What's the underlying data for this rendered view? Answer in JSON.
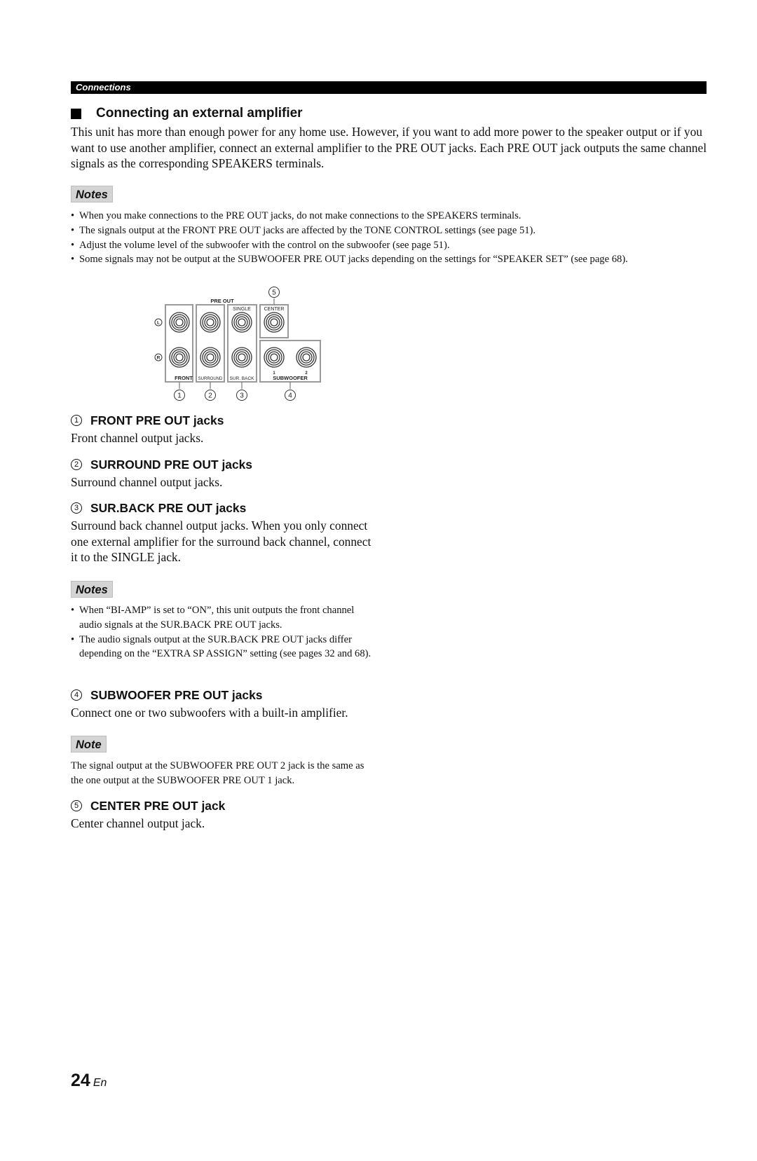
{
  "header": {
    "section": "Connections"
  },
  "section": {
    "title": "Connecting an external amplifier",
    "intro": "This unit has more than enough power for any home use. However, if you want to add more power to the speaker output or if you want to use another amplifier, connect an external amplifier to the PRE OUT jacks. Each PRE OUT jack outputs the same channel signals as the corresponding SPEAKERS terminals."
  },
  "notes_top": {
    "label": "Notes",
    "items": [
      "When you make connections to the PRE OUT jacks, do not make connections to the SPEAKERS terminals.",
      "The signals output at the FRONT PRE OUT jacks are affected by the TONE CONTROL settings (see page 51).",
      "Adjust the volume level of the subwoofer with the control on the subwoofer (see page 51).",
      "Some signals may not be output at the SUBWOOFER PRE OUT jacks depending on the settings for “SPEAKER SET” (see page 68)."
    ]
  },
  "diagram": {
    "title": "PRE OUT",
    "channel_left": "L",
    "channel_right": "R",
    "groups": {
      "front": "FRONT",
      "surround": "SURROUND",
      "sur_back": "SUR. BACK",
      "single": "SINGLE",
      "center": "CENTER",
      "subwoofer": "SUBWOOFER",
      "sub1": "1",
      "sub2": "2"
    },
    "callouts": [
      "1",
      "2",
      "3",
      "4",
      "5"
    ]
  },
  "items": [
    {
      "num": "1",
      "title": "FRONT PRE OUT jacks",
      "body": "Front channel output jacks."
    },
    {
      "num": "2",
      "title": "SURROUND PRE OUT jacks",
      "body": "Surround channel output jacks."
    },
    {
      "num": "3",
      "title": "SUR.BACK PRE OUT jacks",
      "body": "Surround back channel output jacks. When you only connect one external amplifier for the surround back channel, connect it to the SINGLE jack."
    },
    {
      "num": "4",
      "title": "SUBWOOFER PRE OUT jacks",
      "body": "Connect one or two subwoofers with a built-in amplifier."
    },
    {
      "num": "5",
      "title": "CENTER PRE OUT jack",
      "body": "Center channel output jack."
    }
  ],
  "notes_surback": {
    "label": "Notes",
    "items": [
      "When “BI-AMP” is set to “ON”, this unit outputs the front channel audio signals at the SUR.BACK PRE OUT jacks.",
      "The audio signals output at the SUR.BACK PRE OUT jacks differ depending on the “EXTRA SP ASSIGN” setting (see pages 32 and 68)."
    ]
  },
  "note_subwoofer": {
    "label": "Note",
    "text": "The signal output at the SUBWOOFER PRE OUT 2 jack is the same as the one output at the SUBWOOFER PRE OUT 1 jack."
  },
  "footer": {
    "page": "24",
    "lang": "En"
  }
}
